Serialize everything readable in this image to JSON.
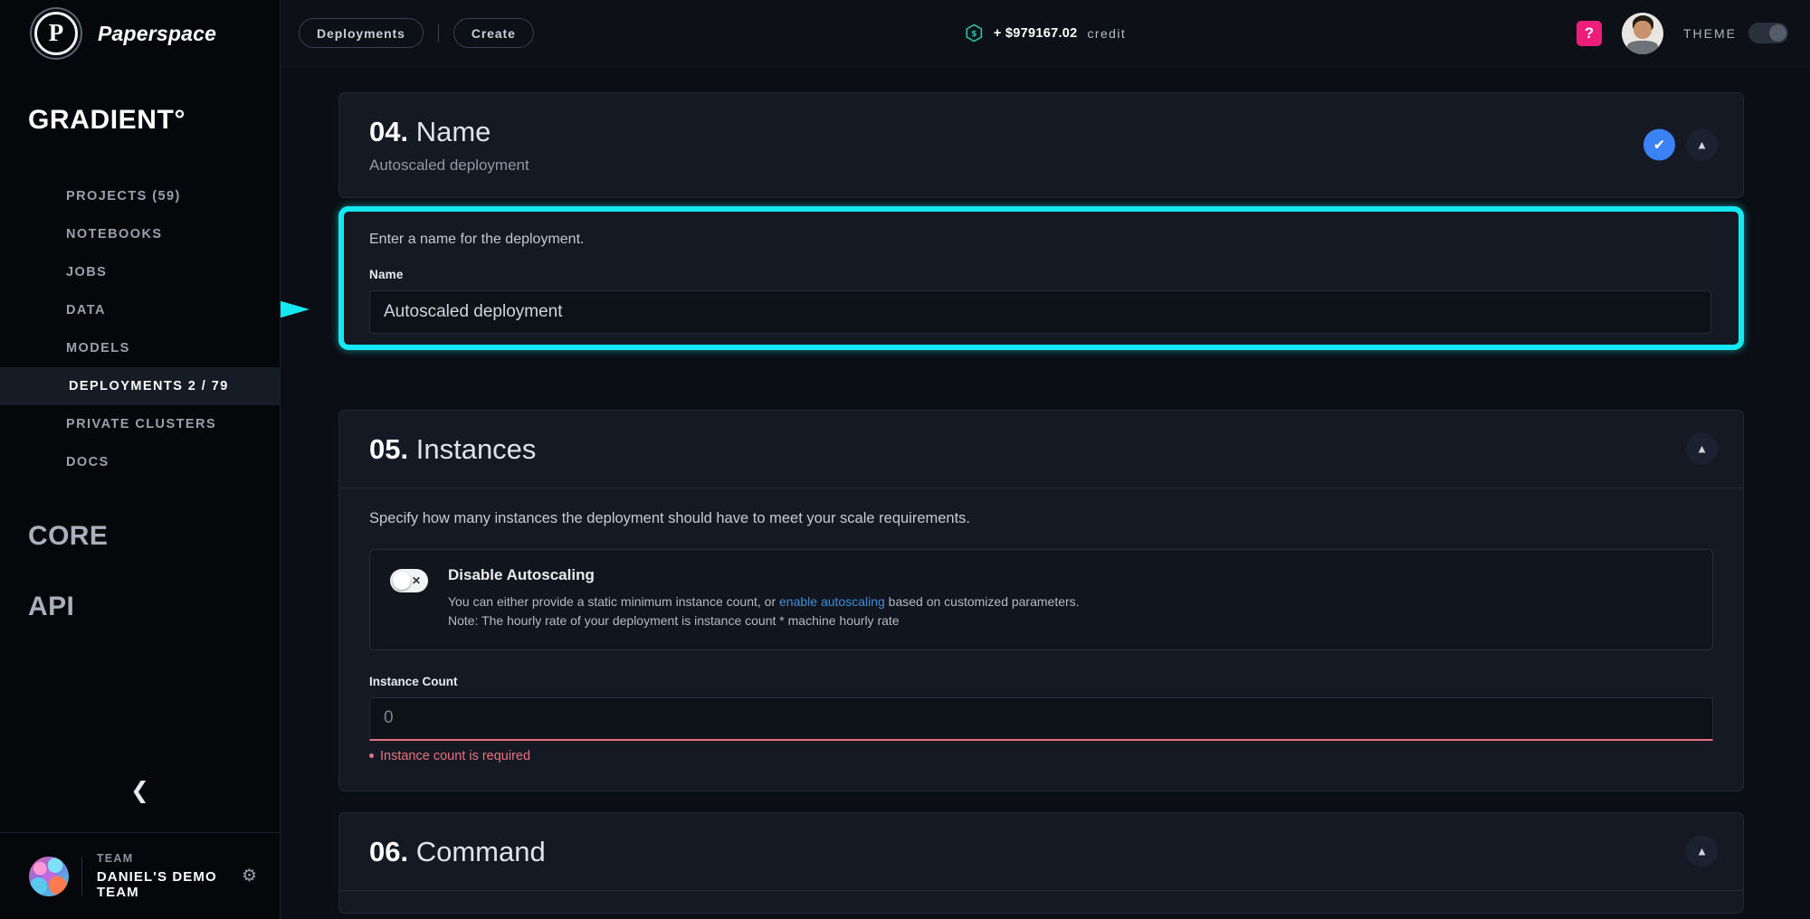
{
  "brand": {
    "logo_letter": "P",
    "name": "Paperspace"
  },
  "sidebar": {
    "title": "GRADIENT°",
    "items": [
      {
        "label": "PROJECTS (59)",
        "name": "projects",
        "active": false
      },
      {
        "label": "NOTEBOOKS",
        "name": "notebooks",
        "active": false
      },
      {
        "label": "JOBS",
        "name": "jobs",
        "active": false
      },
      {
        "label": "DATA",
        "name": "data",
        "active": false
      },
      {
        "label": "MODELS",
        "name": "models",
        "active": false
      },
      {
        "label": "DEPLOYMENTS 2 / 79",
        "name": "deployments",
        "active": true
      },
      {
        "label": "PRIVATE CLUSTERS",
        "name": "private-clusters",
        "active": false
      },
      {
        "label": "DOCS",
        "name": "docs",
        "active": false
      }
    ],
    "major_sections": [
      {
        "label": "CORE",
        "name": "core"
      },
      {
        "label": "API",
        "name": "api"
      }
    ],
    "collapse_icon": "chevron-left-icon",
    "team": {
      "label": "TEAM",
      "name": "DANIEL'S DEMO TEAM",
      "settings_icon": "gear-icon"
    }
  },
  "topbar": {
    "breadcrumb": "Deployments",
    "action": "Create",
    "credit": {
      "icon": "dollar-hexagon-icon",
      "amount": "+ $979167.02",
      "word": "credit"
    },
    "help_badge": "?",
    "theme_label": "THEME",
    "theme_on": false
  },
  "sections": {
    "name": {
      "number": "04.",
      "title": "Name",
      "subtitle": "Autoscaled deployment",
      "status_icon": "check-icon",
      "collapse_icon": "chevron-up-icon",
      "helper": "Enter a name for the deployment.",
      "field_label": "Name",
      "field_value": "Autoscaled deployment"
    },
    "instances": {
      "number": "05.",
      "title": "Instances",
      "collapse_icon": "chevron-up-icon",
      "description": "Specify how many instances the deployment should have to meet your scale requirements.",
      "autoscale": {
        "toggle_state": "off",
        "toggle_glyph": "✕",
        "title": "Disable Autoscaling",
        "desc_before": "You can either provide a static minimum instance count, or ",
        "desc_link": "enable autoscaling",
        "desc_after": " based on customized parameters.",
        "note": "Note: The hourly rate of your deployment is instance count * machine hourly rate"
      },
      "count_label": "Instance Count",
      "count_placeholder": "0",
      "count_value": "",
      "error": "Instance count is required"
    },
    "command": {
      "number": "06.",
      "title": "Command",
      "collapse_icon": "chevron-up-icon"
    }
  },
  "annotation": {
    "arrow": "right-arrow-annotation",
    "color": "#14e8f0"
  },
  "colors": {
    "accent_cyan": "#14e8f0",
    "accent_blue": "#3b82f6",
    "error_red": "#e8737f",
    "link_blue": "#3f8ddb",
    "help_pink": "#ed1e79",
    "credit_teal": "#2bbfa8"
  }
}
